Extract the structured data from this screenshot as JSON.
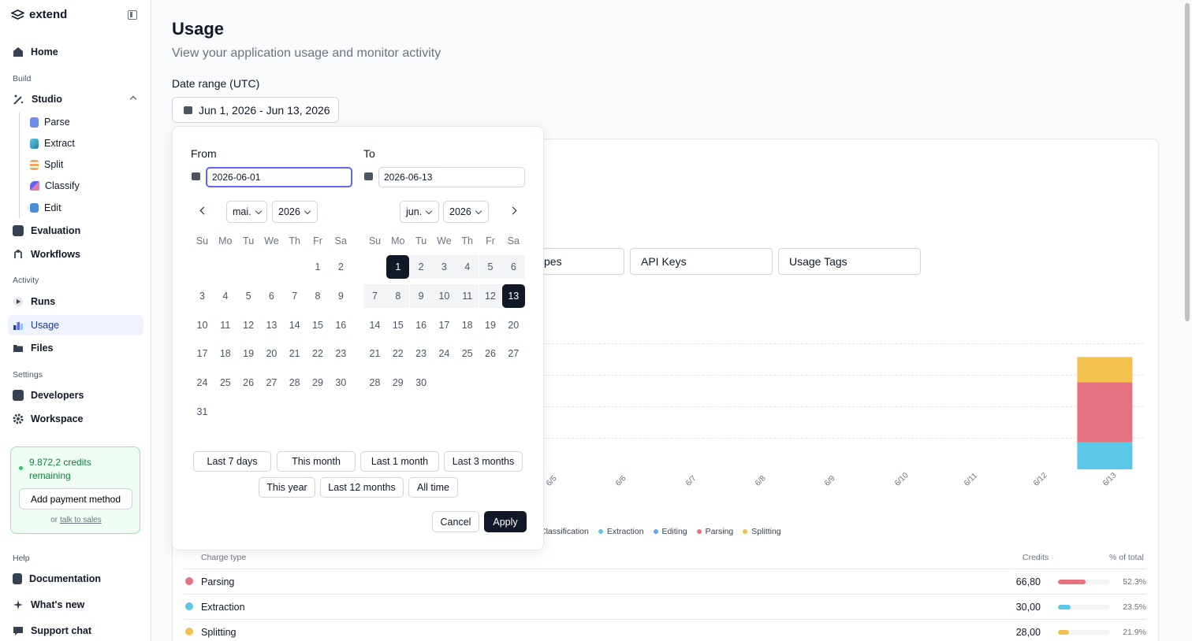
{
  "app": {
    "name": "extend"
  },
  "sidebar": {
    "home": "Home",
    "build_label": "Build",
    "studio": "Studio",
    "studio_items": [
      "Parse",
      "Extract",
      "Split",
      "Classify",
      "Edit"
    ],
    "evaluation": "Evaluation",
    "workflows": "Workflows",
    "activity_label": "Activity",
    "runs": "Runs",
    "usage": "Usage",
    "files": "Files",
    "settings_label": "Settings",
    "developers": "Developers",
    "workspace": "Workspace",
    "credits_text": "9.872,2 credits remaining",
    "add_payment": "Add payment method",
    "or": "or",
    "talk_to_sales": "talk to sales",
    "help_label": "Help",
    "documentation": "Documentation",
    "whats_new": "What's new",
    "support_chat": "Support chat"
  },
  "page": {
    "title": "Usage",
    "subtitle": "View your application usage and monitor activity",
    "range_label": "Date range (UTC)",
    "range_value": "Jun 1, 2026 - Jun 13, 2026"
  },
  "filters": {
    "partial": "pes",
    "api_keys": "API Keys",
    "usage_tags": "Usage Tags"
  },
  "chart_data": {
    "type": "bar",
    "categories": [
      "6/5",
      "6/6",
      "6/7",
      "6/8",
      "6/9",
      "6/10",
      "6/11",
      "6/12",
      "6/13"
    ],
    "series": [
      {
        "name": "Classification",
        "values": [
          0,
          0,
          0,
          0,
          0,
          0,
          0,
          0,
          0
        ]
      },
      {
        "name": "Extraction",
        "values": [
          0,
          0,
          0,
          0,
          0,
          0,
          0,
          0,
          30
        ]
      },
      {
        "name": "Editing",
        "values": [
          0,
          0,
          0,
          0,
          0,
          0,
          0,
          0,
          0
        ]
      },
      {
        "name": "Parsing",
        "values": [
          0,
          0,
          0,
          0,
          0,
          0,
          0,
          0,
          66.8
        ]
      },
      {
        "name": "Splitting",
        "values": [
          0,
          0,
          0,
          0,
          0,
          0,
          0,
          0,
          28
        ]
      }
    ],
    "legend_colors": {
      "Classification": "#a78bfa",
      "Extraction": "#5bc8e8",
      "Editing": "#60a5fa",
      "Parsing": "#e8717f",
      "Splitting": "#f2c14e"
    }
  },
  "table": {
    "headers": {
      "charge_type": "Charge type",
      "credits": "Credits",
      "pct": "% of total"
    },
    "rows": [
      {
        "name": "Parsing",
        "credits": "66,80",
        "pct": "52.3%",
        "fraction": 0.523,
        "color": "#e8717f"
      },
      {
        "name": "Extraction",
        "credits": "30,00",
        "pct": "23.5%",
        "fraction": 0.235,
        "color": "#5bc8e8"
      },
      {
        "name": "Splitting",
        "credits": "28,00",
        "pct": "21.9%",
        "fraction": 0.219,
        "color": "#f2c14e"
      }
    ]
  },
  "picker": {
    "from_label": "From",
    "to_label": "To",
    "from_value": "2026-06-01",
    "to_value": "2026-06-13",
    "left_month": "mai.",
    "left_year": "2026",
    "right_month": "jun.",
    "right_year": "2026",
    "weekdays": [
      "Su",
      "Mo",
      "Tu",
      "We",
      "Th",
      "Fr",
      "Sa"
    ],
    "left_start_weekday": 5,
    "left_days": 31,
    "right_start_weekday": 1,
    "right_days": 30,
    "selected_start": 1,
    "selected_end": 13,
    "presets_row1": [
      "Last 7 days",
      "This month",
      "Last 1 month",
      "Last 3 months"
    ],
    "presets_row2": [
      "This year",
      "Last 12 months",
      "All time"
    ],
    "cancel": "Cancel",
    "apply": "Apply"
  }
}
